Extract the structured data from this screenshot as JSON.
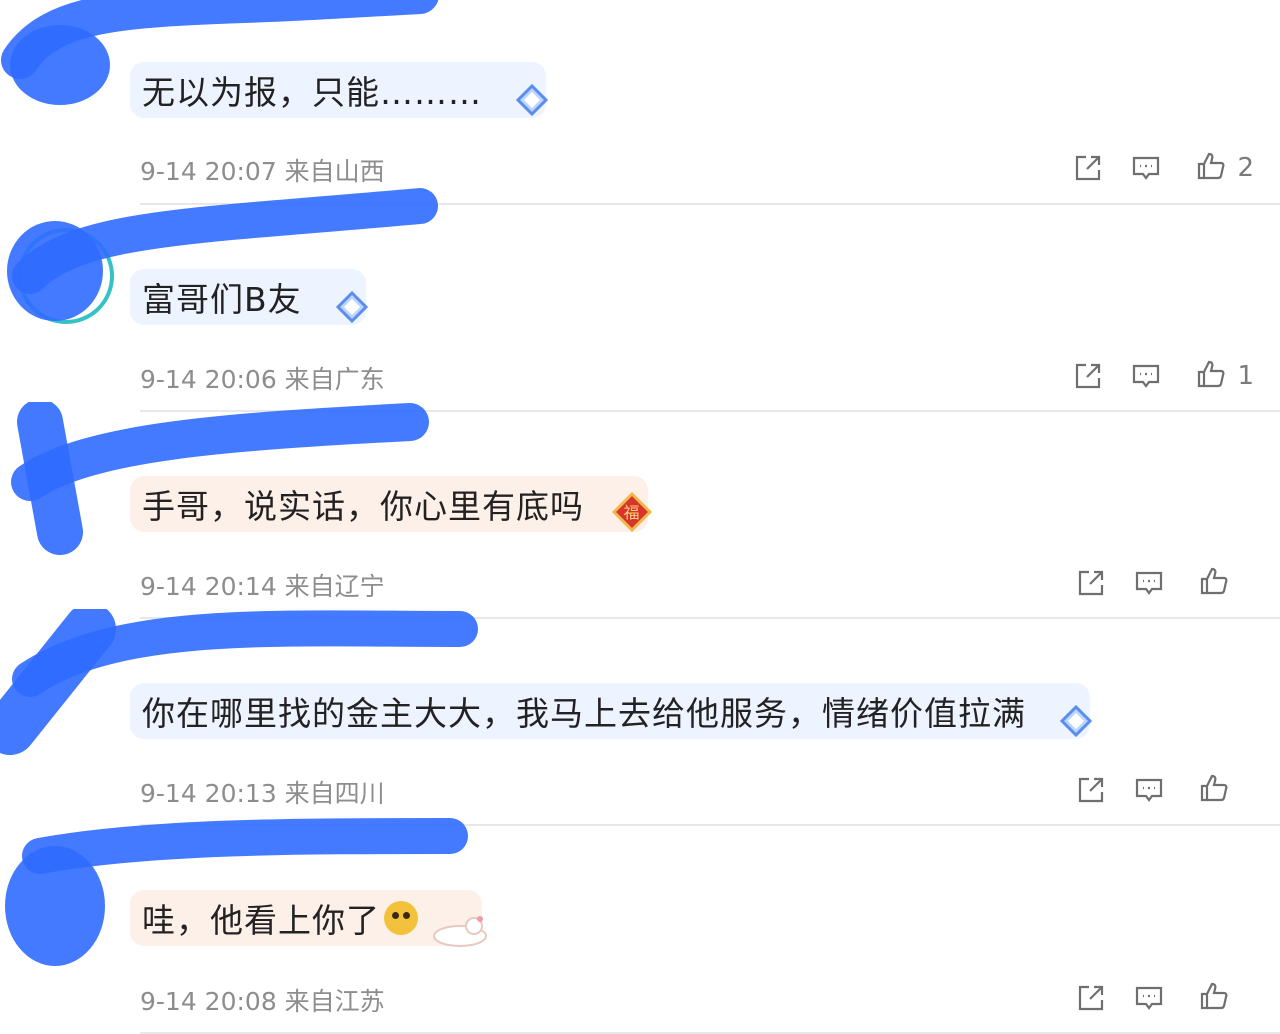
{
  "colors": {
    "accent": "#2f6bff",
    "bubble_blue": "#edf3ff",
    "bubble_warm": "#fdf0e8",
    "meta_text": "#8d8d8d",
    "divider": "#e8e8e8",
    "icon_stroke": "#6f6f6f"
  },
  "comments": [
    {
      "text": "无以为报，只能………",
      "meta": "9-14 20:07 来自山西",
      "likes": "2",
      "bubble_style": "blue",
      "decoration": "diamond-badge-icon"
    },
    {
      "text": "富哥们B友",
      "meta": "9-14 20:06 来自广东",
      "likes": "1",
      "bubble_style": "blue",
      "decoration": "diamond-badge-icon"
    },
    {
      "text": "手哥，说实话，你心里有底吗",
      "meta": "9-14 20:14 来自辽宁",
      "likes": "",
      "bubble_style": "warm",
      "decoration": "fu-badge-icon"
    },
    {
      "text": "你在哪里找的金主大大，我马上去给他服务，情绪价值拉满",
      "meta": "9-14 20:13 来自四川",
      "likes": "",
      "bubble_style": "blue",
      "decoration": "diamond-badge-icon"
    },
    {
      "text": "哇，他看上你了",
      "meta": "9-14 20:08 来自江苏",
      "likes": "",
      "bubble_style": "warm",
      "decoration": "cat-sticker-icon"
    }
  ]
}
